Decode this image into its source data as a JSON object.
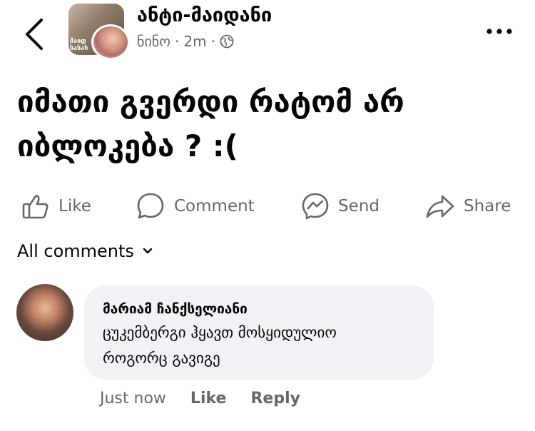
{
  "header": {
    "group_name": "ანტი-მაიდანი",
    "author": "ნინო",
    "separator": "·",
    "time": "2m",
    "avatar_badge": "მაიდ\nსასახ",
    "audience_icon": "globe-icon",
    "back_icon": "chevron-left-icon",
    "more_icon": "more-dots-icon"
  },
  "post": {
    "text": "იმათი გვერდი რატომ არ\nიბლოკება  ? :("
  },
  "actions": {
    "like": "Like",
    "comment": "Comment",
    "send": "Send",
    "share": "Share"
  },
  "comments_section": {
    "filter_label": "All comments"
  },
  "comment": {
    "author": "მარიამ ჩანქსელიანი",
    "text": "ცუკემბერგი ჰყავთ მოსყიდულიო\nროგორც გავიგე",
    "time": "Just now",
    "like": "Like",
    "reply": "Reply"
  },
  "colors": {
    "text": "#050505",
    "secondary": "#65676b",
    "bubble": "#f0f2f5"
  }
}
